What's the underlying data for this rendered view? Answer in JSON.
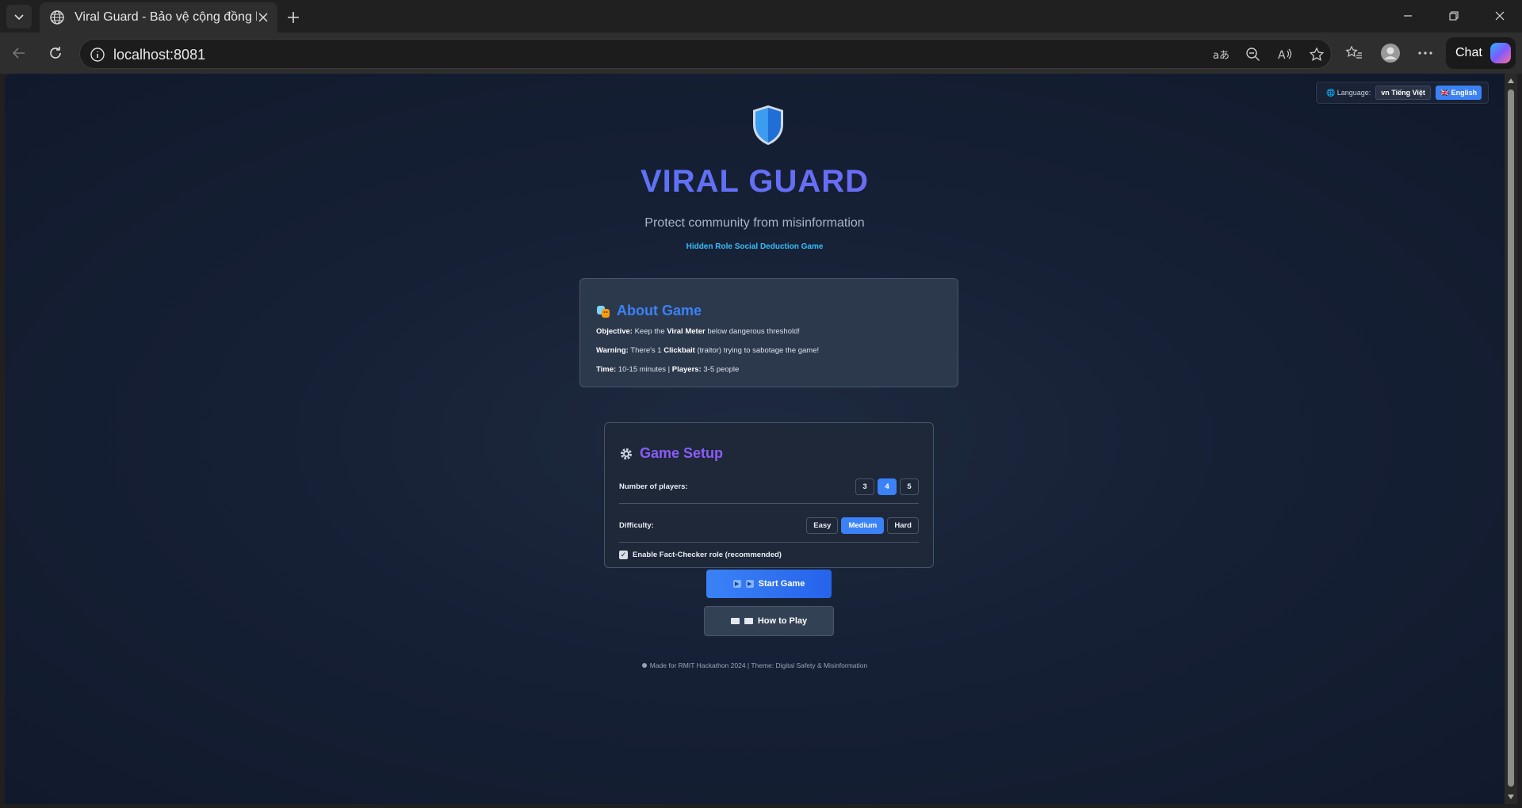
{
  "browser": {
    "tab_title": "Viral Guard - Bảo vệ cộng đồng k",
    "url": "localhost:8081",
    "chat_label": "Chat"
  },
  "page": {
    "language": {
      "label": "🌐 Language:",
      "vi": "vn Tiếng Việt",
      "en": "🇬🇧 English"
    },
    "title": "VIRAL GUARD",
    "subtitle": "Protect community from misinformation",
    "tagline": "Hidden Role Social Deduction Game",
    "about": {
      "heading": "About Game",
      "objective_label": "Objective:",
      "objective_pre": "Keep the",
      "objective_bold": "Viral Meter",
      "objective_post": "below dangerous threshold!",
      "warning_label": "Warning:",
      "warning_pre": "There's 1",
      "warning_bold": "Clickbait",
      "warning_post": "(traitor) trying to sabotage the game!",
      "time_label": "Time:",
      "time_value": "10-15 minutes |",
      "players_label": "Players:",
      "players_value": "3-5 people"
    },
    "setup": {
      "heading": "Game Setup",
      "players_label": "Number of players:",
      "player_options": [
        "3",
        "4",
        "5"
      ],
      "players_selected": "4",
      "difficulty_label": "Difficulty:",
      "difficulty_options": [
        "Easy",
        "Medium",
        "Hard"
      ],
      "difficulty_selected": "Medium",
      "fact_checker_label": "Enable Fact-Checker role (recommended)",
      "fact_checker_checked": true
    },
    "start_label": "Start Game",
    "how_label": "How to Play",
    "footer": "Made for RMIT Hackathon 2024 | Theme: Digital Safety & Misinformation"
  },
  "colors": {
    "accent_blue": "#3b82f6",
    "accent_purple": "#8b5cf6",
    "tagline": "#38bdf8"
  }
}
